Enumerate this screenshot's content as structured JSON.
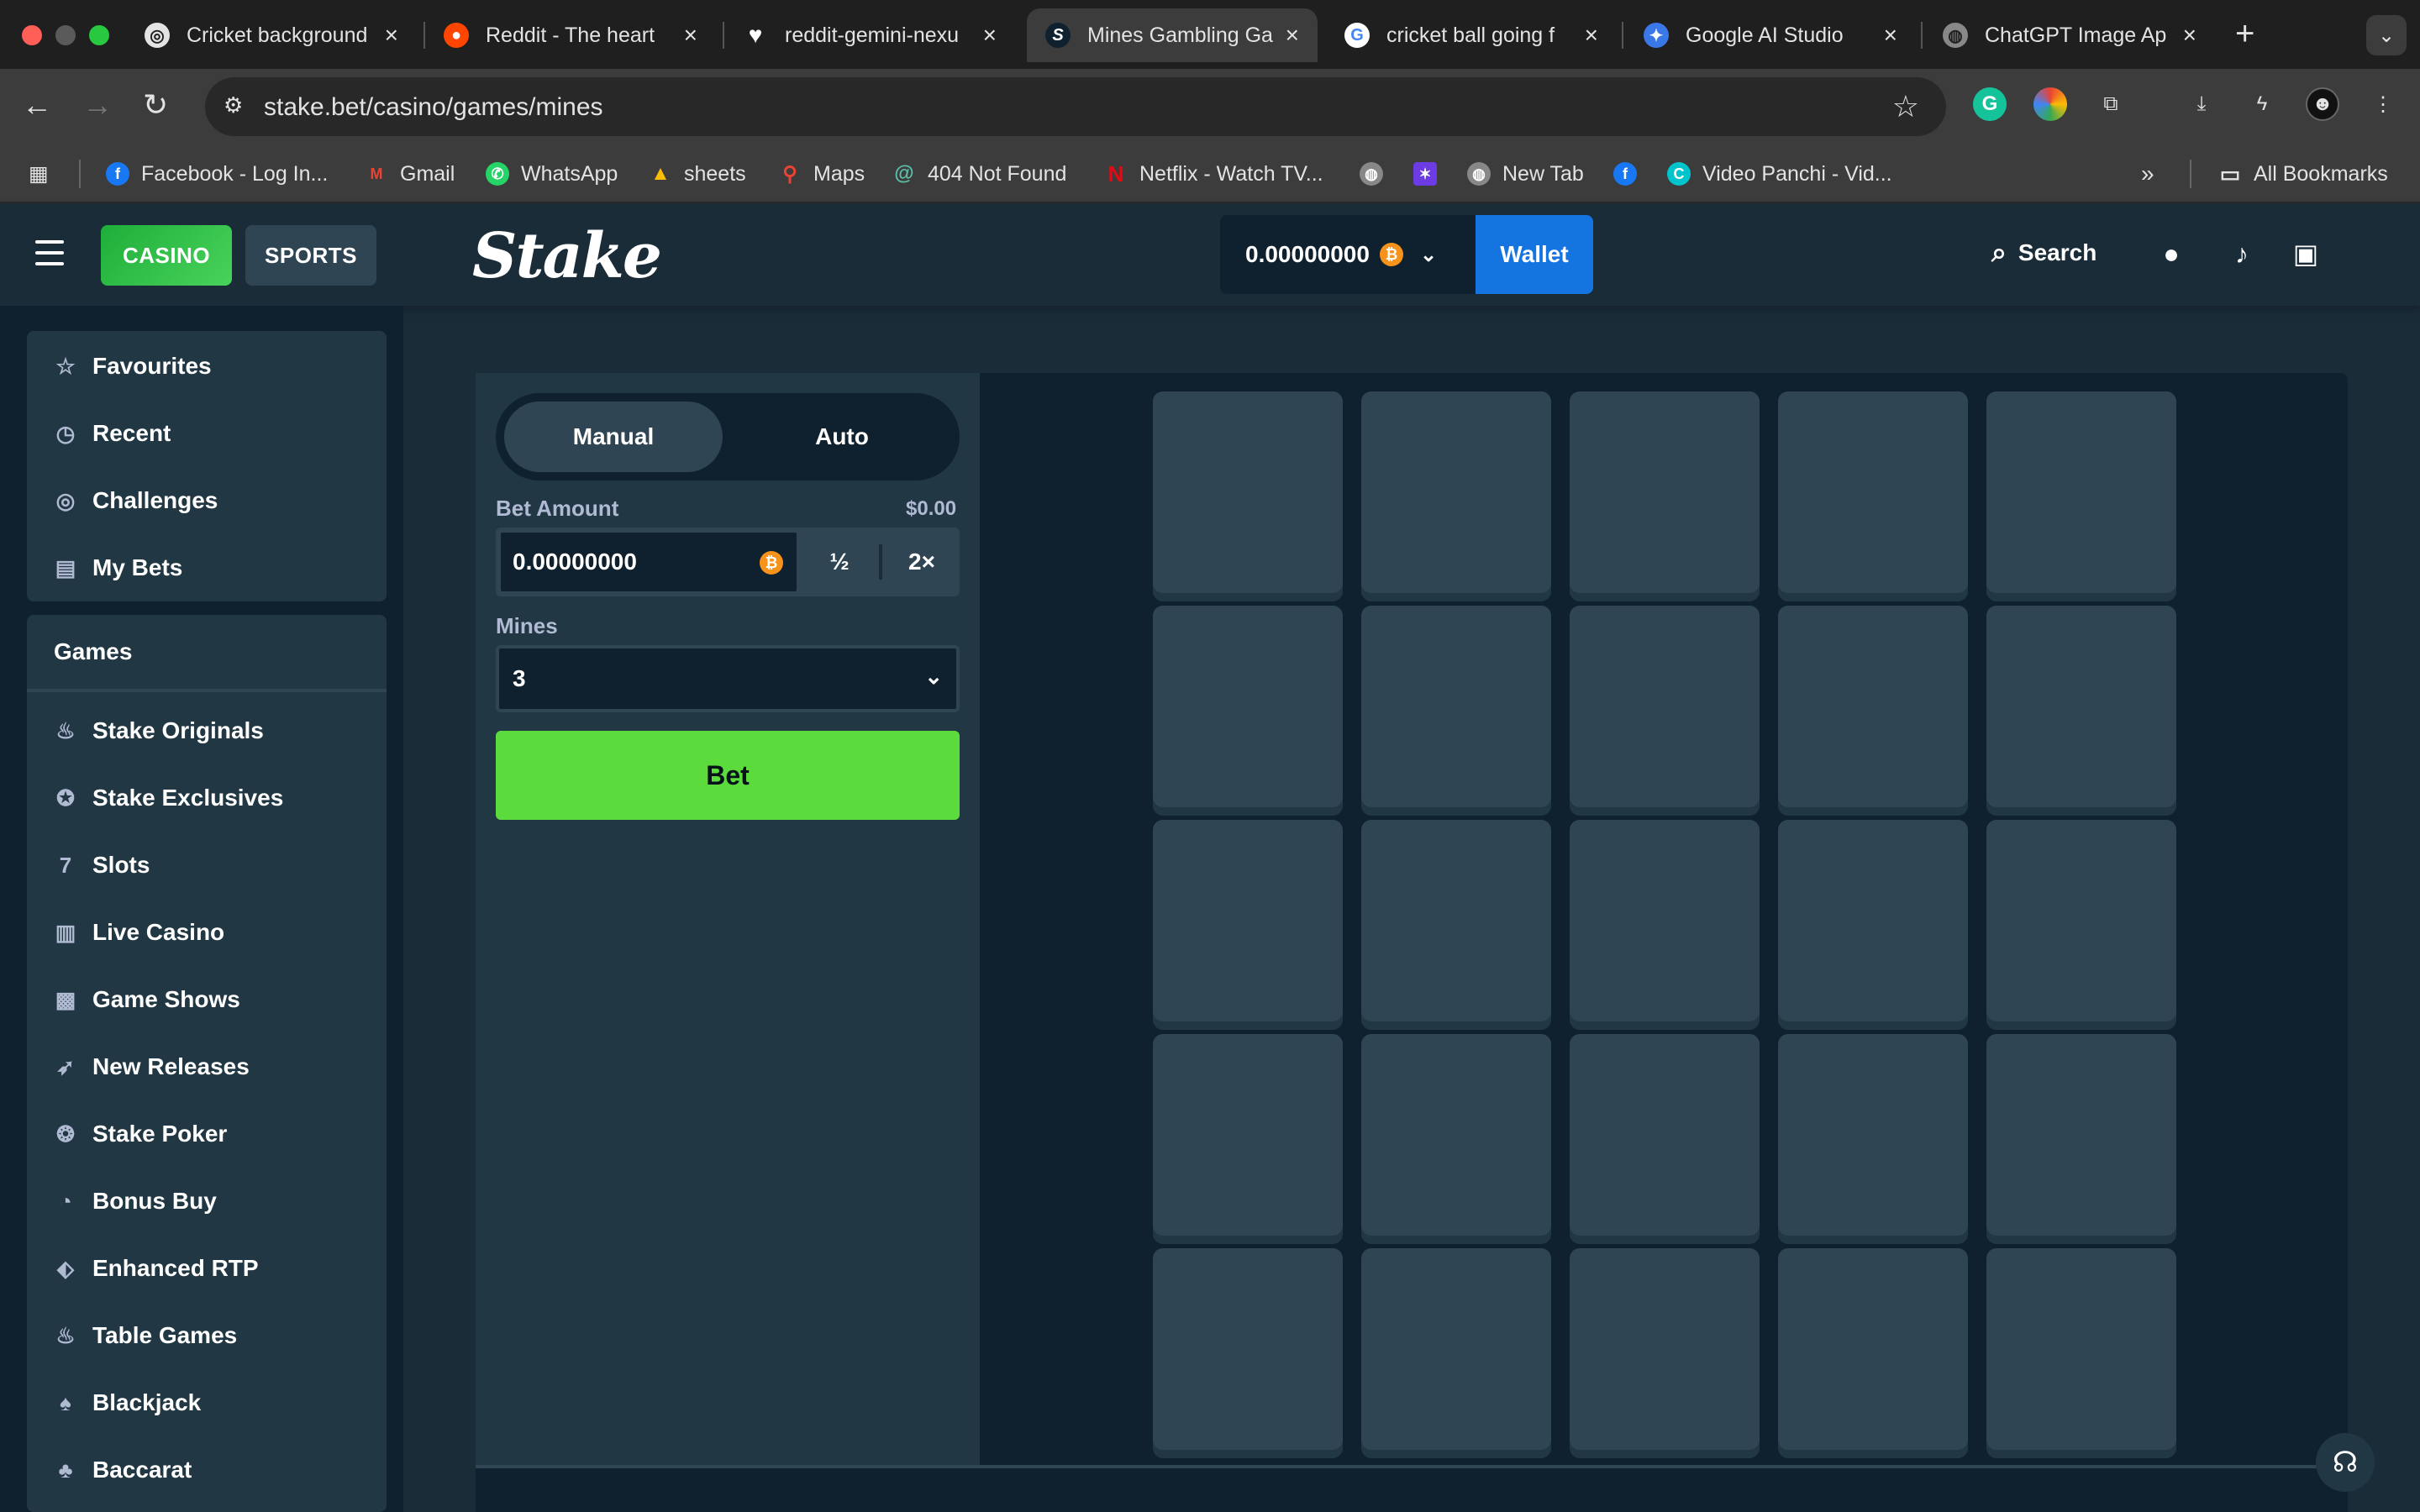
{
  "browser": {
    "tabs": [
      {
        "title": "Cricket background",
        "icon": "openai-icon"
      },
      {
        "title": "Reddit - The heart",
        "icon": "reddit-icon"
      },
      {
        "title": "reddit-gemini-nexu",
        "icon": "heart-icon"
      },
      {
        "title": "Mines Gambling Ga",
        "icon": "stake-icon"
      },
      {
        "title": "cricket ball going f",
        "icon": "google-icon"
      },
      {
        "title": "Google AI Studio",
        "icon": "ai-studio-icon"
      },
      {
        "title": "ChatGPT Image Ap",
        "icon": "globe-icon"
      }
    ],
    "url": "stake.bet/casino/games/mines",
    "bookmarks": [
      {
        "label": "Facebook - Log In...",
        "icon": "facebook-icon"
      },
      {
        "label": "Gmail",
        "icon": "gmail-icon"
      },
      {
        "label": "WhatsApp",
        "icon": "whatsapp-icon"
      },
      {
        "label": "sheets",
        "icon": "drive-icon"
      },
      {
        "label": "Maps",
        "icon": "maps-icon"
      },
      {
        "label": "404 Not Found",
        "icon": "swirl-icon"
      },
      {
        "label": "Netflix - Watch TV...",
        "icon": "netflix-icon"
      },
      {
        "label": "New Tab",
        "icon": "globe-icon"
      },
      {
        "label": "Video Panchi - Vid...",
        "icon": "canva-icon"
      }
    ],
    "all_bookmarks": "All Bookmarks"
  },
  "header": {
    "casino": "CASINO",
    "sports": "SPORTS",
    "logo": "Stake",
    "balance": "0.00000000",
    "wallet": "Wallet",
    "search": "Search"
  },
  "sidebar": {
    "top_items": [
      {
        "label": "Favourites",
        "icon": "star-icon"
      },
      {
        "label": "Recent",
        "icon": "history-icon"
      },
      {
        "label": "Challenges",
        "icon": "target-icon"
      },
      {
        "label": "My Bets",
        "icon": "receipt-icon"
      }
    ],
    "games_heading": "Games",
    "game_items": [
      {
        "label": "Stake Originals",
        "icon": "flame-icon"
      },
      {
        "label": "Stake Exclusives",
        "icon": "bookmark-star-icon"
      },
      {
        "label": "Slots",
        "icon": "slots-icon"
      },
      {
        "label": "Live Casino",
        "icon": "live-icon"
      },
      {
        "label": "Game Shows",
        "icon": "gift-icon"
      },
      {
        "label": "New Releases",
        "icon": "rocket-icon"
      },
      {
        "label": "Stake Poker",
        "icon": "poker-chip-icon"
      },
      {
        "label": "Bonus Buy",
        "icon": "bonus-icon"
      },
      {
        "label": "Enhanced RTP",
        "icon": "tag-icon"
      },
      {
        "label": "Table Games",
        "icon": "fire-icon"
      },
      {
        "label": "Blackjack",
        "icon": "spade-icon"
      },
      {
        "label": "Baccarat",
        "icon": "cards-icon"
      }
    ]
  },
  "game": {
    "mode_manual": "Manual",
    "mode_auto": "Auto",
    "bet_amount_label": "Bet Amount",
    "bet_amount_usd": "$0.00",
    "bet_amount_value": "0.00000000",
    "half": "½",
    "double": "2×",
    "mines_label": "Mines",
    "mines_value": "3",
    "bet_button": "Bet",
    "grid_rows": 5,
    "grid_cols": 5
  },
  "colors": {
    "accent_green": "#5bdc3c",
    "wallet_blue": "#1475e1",
    "bg_dark": "#0f212e",
    "panel": "#213743",
    "tile": "#2f4553"
  }
}
